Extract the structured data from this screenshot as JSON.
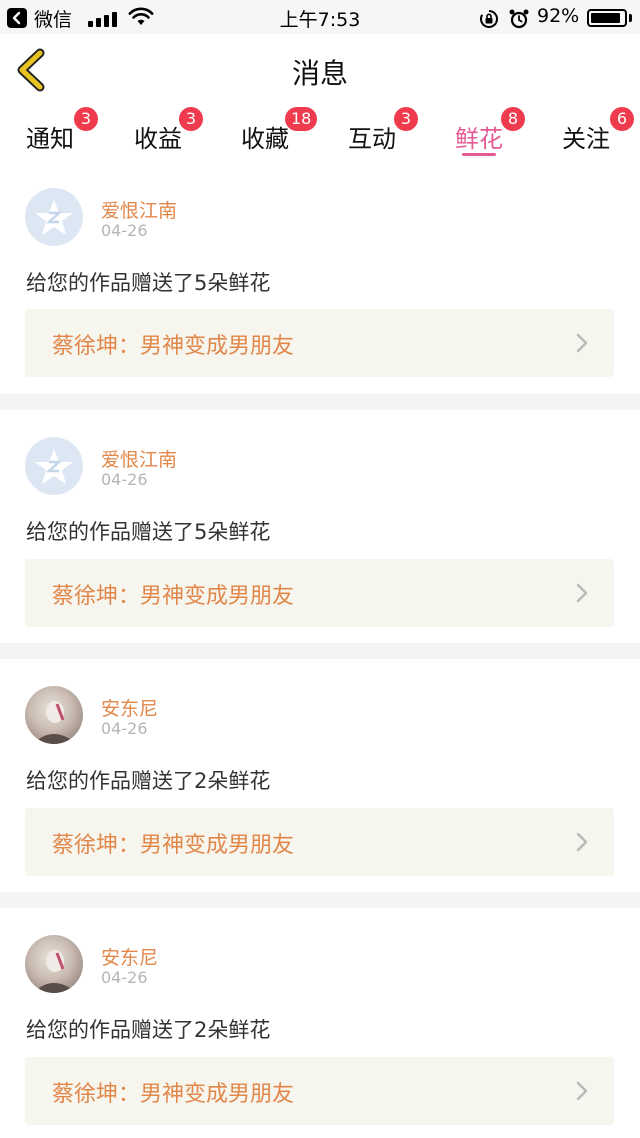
{
  "status_bar": {
    "app_name": "微信",
    "time": "上午7:53",
    "battery_percent_text": "92%",
    "battery_level": 0.92
  },
  "header": {
    "title": "消息",
    "back_icon": "chevron-left-icon",
    "accent_color": "#e8c420"
  },
  "tabs": [
    {
      "label": "通知",
      "badge": "3"
    },
    {
      "label": "收益",
      "badge": "3"
    },
    {
      "label": "收藏",
      "badge": "18"
    },
    {
      "label": "互动",
      "badge": "3"
    },
    {
      "label": "鲜花",
      "badge": "8",
      "active": true
    },
    {
      "label": "关注",
      "badge": "6"
    }
  ],
  "colors": {
    "active_tab": "#e45a95",
    "badge": "#ee3b4d",
    "username": "#e2874a",
    "work_box_bg": "#f6f5ee"
  },
  "messages": [
    {
      "username": "爱恨江南",
      "date": "04-26",
      "text": "给您的作品赠送了5朵鲜花",
      "work_title": "蔡徐坤：男神变成男朋友",
      "avatar": "default-avatar-icon"
    },
    {
      "username": "爱恨江南",
      "date": "04-26",
      "text": "给您的作品赠送了5朵鲜花",
      "work_title": "蔡徐坤：男神变成男朋友",
      "avatar": "default-avatar-icon"
    },
    {
      "username": "安东尼",
      "date": "04-26",
      "text": "给您的作品赠送了2朵鲜花",
      "work_title": "蔡徐坤：男神变成男朋友",
      "avatar": "photo-avatar"
    },
    {
      "username": "安东尼",
      "date": "04-26",
      "text": "给您的作品赠送了2朵鲜花",
      "work_title": "蔡徐坤：男神变成男朋友",
      "avatar": "photo-avatar"
    }
  ]
}
